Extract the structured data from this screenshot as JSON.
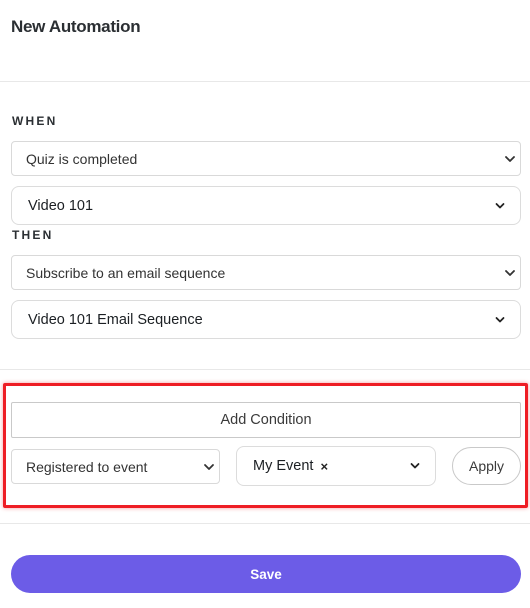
{
  "header": {
    "title": "New Automation"
  },
  "when": {
    "label": "WHEN",
    "trigger": {
      "selected": "Quiz is completed"
    },
    "target": {
      "selected": "Video 101"
    }
  },
  "then": {
    "label": "THEN",
    "action": {
      "selected": "Subscribe to an email sequence"
    },
    "target": {
      "selected": "Video 101 Email Sequence"
    }
  },
  "conditions": {
    "add_label": "Add Condition",
    "condition_type": {
      "selected": "Registered to event"
    },
    "event": {
      "tag": "My Event",
      "remove_glyph": "×"
    },
    "apply_label": "Apply"
  },
  "footer": {
    "save_label": "Save"
  },
  "colors": {
    "accent": "#6c5ce7",
    "highlight": "#ee1d24",
    "border": "#d9d9d9"
  },
  "icons": {
    "select_caret": "chevron-down-icon",
    "dropdown_chevron": "chevron-down-icon",
    "remove_tag": "close-icon"
  }
}
